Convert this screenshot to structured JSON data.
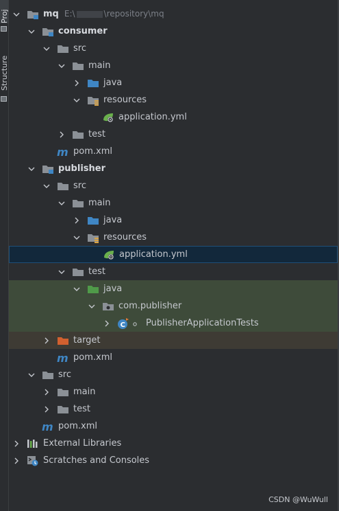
{
  "side_strip": {
    "project_label": "Proj",
    "structure_label": "Structure"
  },
  "colors": {
    "background": "#2b2d30",
    "selection": "#12283b",
    "test_root_bg": "#3e4b3a",
    "excluded_bg": "#3e3b34",
    "folder_gray": "#8b9096",
    "source_blue": "#3f86c4",
    "test_green": "#4f9a49",
    "excluded_orange": "#d1602f",
    "spring_green": "#6ab04c"
  },
  "tree": [
    {
      "level": 0,
      "expanded": true,
      "icon": "module-folder-icon",
      "label": "mq",
      "bold": true,
      "path_prefix": "E:\\",
      "path_suffix": "\\repository\\mq"
    },
    {
      "level": 1,
      "expanded": true,
      "icon": "module-folder-icon",
      "label": "consumer",
      "bold": true
    },
    {
      "level": 2,
      "expanded": true,
      "icon": "folder-icon",
      "label": "src"
    },
    {
      "level": 3,
      "expanded": true,
      "icon": "folder-icon",
      "label": "main"
    },
    {
      "level": 4,
      "expanded": false,
      "icon": "source-folder-icon",
      "label": "java"
    },
    {
      "level": 4,
      "expanded": true,
      "icon": "resources-folder-icon",
      "label": "resources"
    },
    {
      "level": 5,
      "icon": "spring-config-icon",
      "label": "application.yml"
    },
    {
      "level": 3,
      "expanded": false,
      "icon": "folder-icon",
      "label": "test"
    },
    {
      "level": 2,
      "icon": "maven-icon",
      "label": "pom.xml"
    },
    {
      "level": 1,
      "expanded": true,
      "icon": "module-folder-icon",
      "label": "publisher",
      "bold": true
    },
    {
      "level": 2,
      "expanded": true,
      "icon": "folder-icon",
      "label": "src"
    },
    {
      "level": 3,
      "expanded": true,
      "icon": "folder-icon",
      "label": "main"
    },
    {
      "level": 4,
      "expanded": false,
      "icon": "source-folder-icon",
      "label": "java"
    },
    {
      "level": 4,
      "expanded": true,
      "icon": "resources-folder-icon",
      "label": "resources"
    },
    {
      "level": 5,
      "icon": "spring-config-icon",
      "label": "application.yml",
      "selected": true
    },
    {
      "level": 3,
      "expanded": true,
      "icon": "folder-icon",
      "label": "test"
    },
    {
      "level": 4,
      "expanded": true,
      "icon": "test-folder-icon",
      "label": "java",
      "row_style": "gtest"
    },
    {
      "level": 5,
      "expanded": true,
      "icon": "package-icon",
      "label": "com.publisher",
      "row_style": "gtest"
    },
    {
      "level": 6,
      "expanded": false,
      "icon": "test-class-icon",
      "label": "PublisherApplicationTests",
      "row_style": "gtest"
    },
    {
      "level": 2,
      "expanded": false,
      "icon": "excluded-folder-icon",
      "label": "target",
      "row_style": "excl"
    },
    {
      "level": 2,
      "icon": "maven-icon",
      "label": "pom.xml"
    },
    {
      "level": 1,
      "expanded": true,
      "icon": "folder-icon",
      "label": "src"
    },
    {
      "level": 2,
      "expanded": false,
      "icon": "folder-icon",
      "label": "main"
    },
    {
      "level": 2,
      "expanded": false,
      "icon": "folder-icon",
      "label": "test"
    },
    {
      "level": 1,
      "icon": "maven-icon",
      "label": "pom.xml"
    },
    {
      "level": 0,
      "expanded": false,
      "icon": "libraries-icon",
      "label": "External Libraries"
    },
    {
      "level": 0,
      "expanded": false,
      "icon": "scratches-icon",
      "label": "Scratches and Consoles"
    }
  ],
  "watermark": "CSDN @WuWull"
}
